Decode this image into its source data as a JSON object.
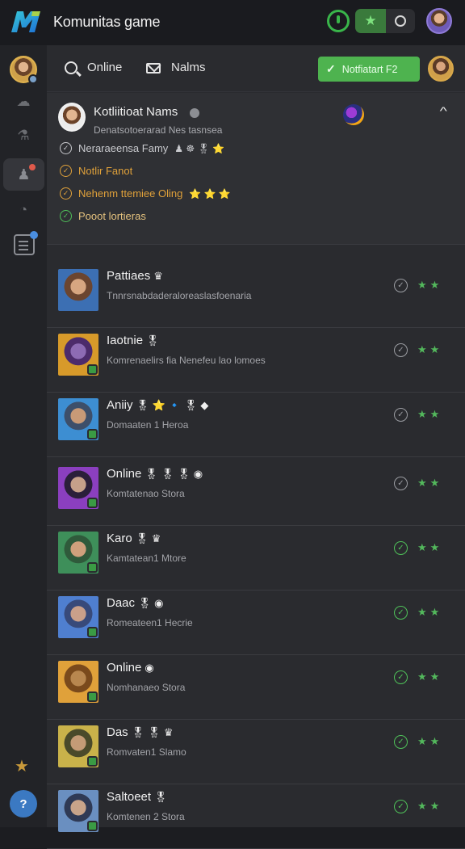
{
  "header": {
    "logo_icon": "komunitas-logo-icon",
    "title": "Komunitas game"
  },
  "topbar_icons": [
    "power-icon",
    "puzzle-star-icon",
    "circle-icon",
    "user-avatar"
  ],
  "colors": {
    "accent": "#4eb34f",
    "background": "#2a2b2f",
    "sidebar": "#222327",
    "star": "#53b85c"
  },
  "sidebar": {
    "items": [
      {
        "name": "profile-avatar"
      },
      {
        "name": "chat-icon",
        "glyph": "☁"
      },
      {
        "name": "games-icon",
        "glyph": "⚗"
      },
      {
        "name": "community-icon",
        "glyph": "♟"
      },
      {
        "name": "clock-icon",
        "glyph": "◔"
      },
      {
        "name": "document-icon"
      }
    ],
    "footer": {
      "star_glyph": "★",
      "help_glyph": "?"
    }
  },
  "subbar": {
    "online_label": "Online",
    "names_label": "Nalms",
    "cta_label": "Notfiatart F2"
  },
  "profile": {
    "name": "Kotliitioat Nams",
    "subtitle": "Denatsotoerarad Nes tasnsea",
    "rows": [
      {
        "label": "Neraraeensa Famy",
        "badges": "♟ ☸ 🎖 ⭐"
      },
      {
        "label": "Notlir Fanot",
        "badges": ""
      },
      {
        "label": "Nehenm ttemiee Oling",
        "badges": "⭐ ⭐ ⭐"
      },
      {
        "label": "Pooot lortieras",
        "badges": ""
      }
    ]
  },
  "players": [
    {
      "name": "Pattiaes",
      "badges": "♛",
      "sub": "Tnnrsnabdaderaloreaslasfoenaria",
      "check": "gray"
    },
    {
      "name": "Iaotnie",
      "badges": "🎖",
      "sub": "Komrenaelirs fia Nenefeu lao lomoes",
      "check": "gray"
    },
    {
      "name": "Aniiy",
      "badges": "🎖 ⭐ 🔹 🎖 ◆",
      "sub": "Domaaten 1 Heroa",
      "check": "gray"
    },
    {
      "name": "Online",
      "badges": "🎖 🎖 🎖 ◉",
      "sub": "Komtatenao Stora",
      "check": "gray"
    },
    {
      "name": "Karo",
      "badges": "🎖 ♛",
      "sub": "Kamtatean1 Mtore",
      "check": "green"
    },
    {
      "name": "Daac",
      "badges": "🎖 ◉",
      "sub": "Romeateen1 Hecrie",
      "check": "green"
    },
    {
      "name": "Online",
      "badges": "◉",
      "sub": "Nomhanaeo Stora",
      "check": "green"
    },
    {
      "name": "Das",
      "badges": "🎖 🎖 ♛",
      "sub": "Romvaten1 Slamo",
      "check": "green"
    },
    {
      "name": "Saltoeet",
      "badges": "🎖",
      "sub": "Komtenen 2 Stora",
      "check": "green"
    }
  ]
}
